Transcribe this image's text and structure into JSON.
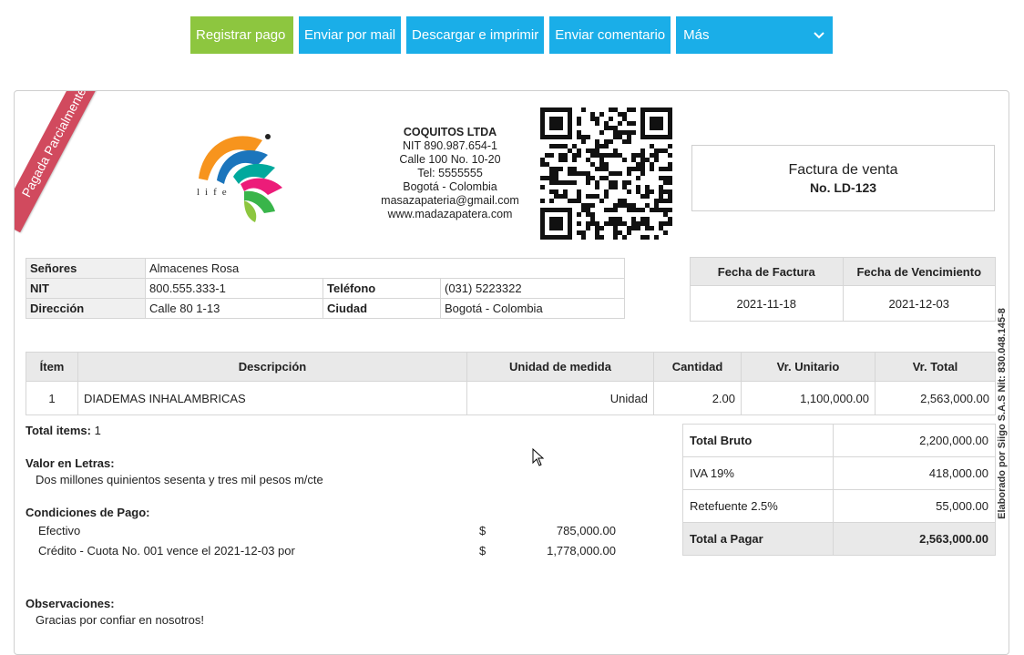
{
  "toolbar": {
    "register_payment": "Registrar pago",
    "send_mail": "Enviar por mail",
    "download_print": "Descargar e imprimir",
    "send_comment": "Enviar comentario",
    "more": "Más",
    "colors": {
      "green": "#8dc63f",
      "blue": "#1aaee8"
    }
  },
  "ribbon": {
    "text": "Pagada Parcialmente",
    "color": "#d14a5e"
  },
  "logo": {
    "text": "life"
  },
  "company": {
    "name": "COQUITOS LTDA",
    "nit": "NIT 890.987.654-1",
    "address": "Calle 100 No. 10-20",
    "phone": "Tel: 5555555",
    "city": "Bogotá - Colombia",
    "email": "masazapateria@gmail.com",
    "web": "www.madazapatera.com"
  },
  "document": {
    "type": "Factura de venta",
    "number": "No. LD-123"
  },
  "client": {
    "labels": {
      "name": "Señores",
      "nit": "NIT",
      "phone": "Teléfono",
      "address": "Dirección",
      "city": "Ciudad"
    },
    "name": "Almacenes Rosa",
    "nit": "800.555.333-1",
    "phone": "(031) 5223322",
    "address": "Calle 80 1-13",
    "city": "Bogotá - Colombia"
  },
  "dates": {
    "invoice_label": "Fecha de Factura",
    "due_label": "Fecha de Vencimiento",
    "invoice": "2021-11-18",
    "due": "2021-12-03"
  },
  "items": {
    "headers": [
      "Ítem",
      "Descripción",
      "Unidad de medida",
      "Cantidad",
      "Vr. Unitario",
      "Vr. Total"
    ],
    "rows": [
      [
        "1",
        "DIADEMAS INHALAMBRICAS",
        "Unidad",
        "2.00",
        "1,100,000.00",
        "2,563,000.00"
      ]
    ]
  },
  "summary": {
    "total_items_label": "Total items:",
    "total_items": "1",
    "words_label": "Valor en Letras:",
    "words": "Dos millones quinientos sesenta y tres mil pesos m/cte",
    "conditions_label": "Condiciones de Pago:",
    "conditions": [
      {
        "desc": "Efectivo",
        "currency": "$",
        "amount": "785,000.00"
      },
      {
        "desc": "Crédito - Cuota No. 001 vence el 2021-12-03 por",
        "currency": "$",
        "amount": "1,778,000.00"
      }
    ],
    "observations_label": "Observaciones:",
    "observations": "Gracias por confiar en nosotros!"
  },
  "totals": {
    "gross_label": "Total Bruto",
    "gross": "2,200,000.00",
    "iva_label": "IVA 19%",
    "iva": "418,000.00",
    "retention_label": "Retefuente 2.5%",
    "retention": "55,000.00",
    "total_label": "Total a Pagar",
    "total": "2,563,000.00"
  },
  "sidebar": {
    "text": "Elaborado por Siigo S.A.S Nit: 830.048.145-8"
  }
}
